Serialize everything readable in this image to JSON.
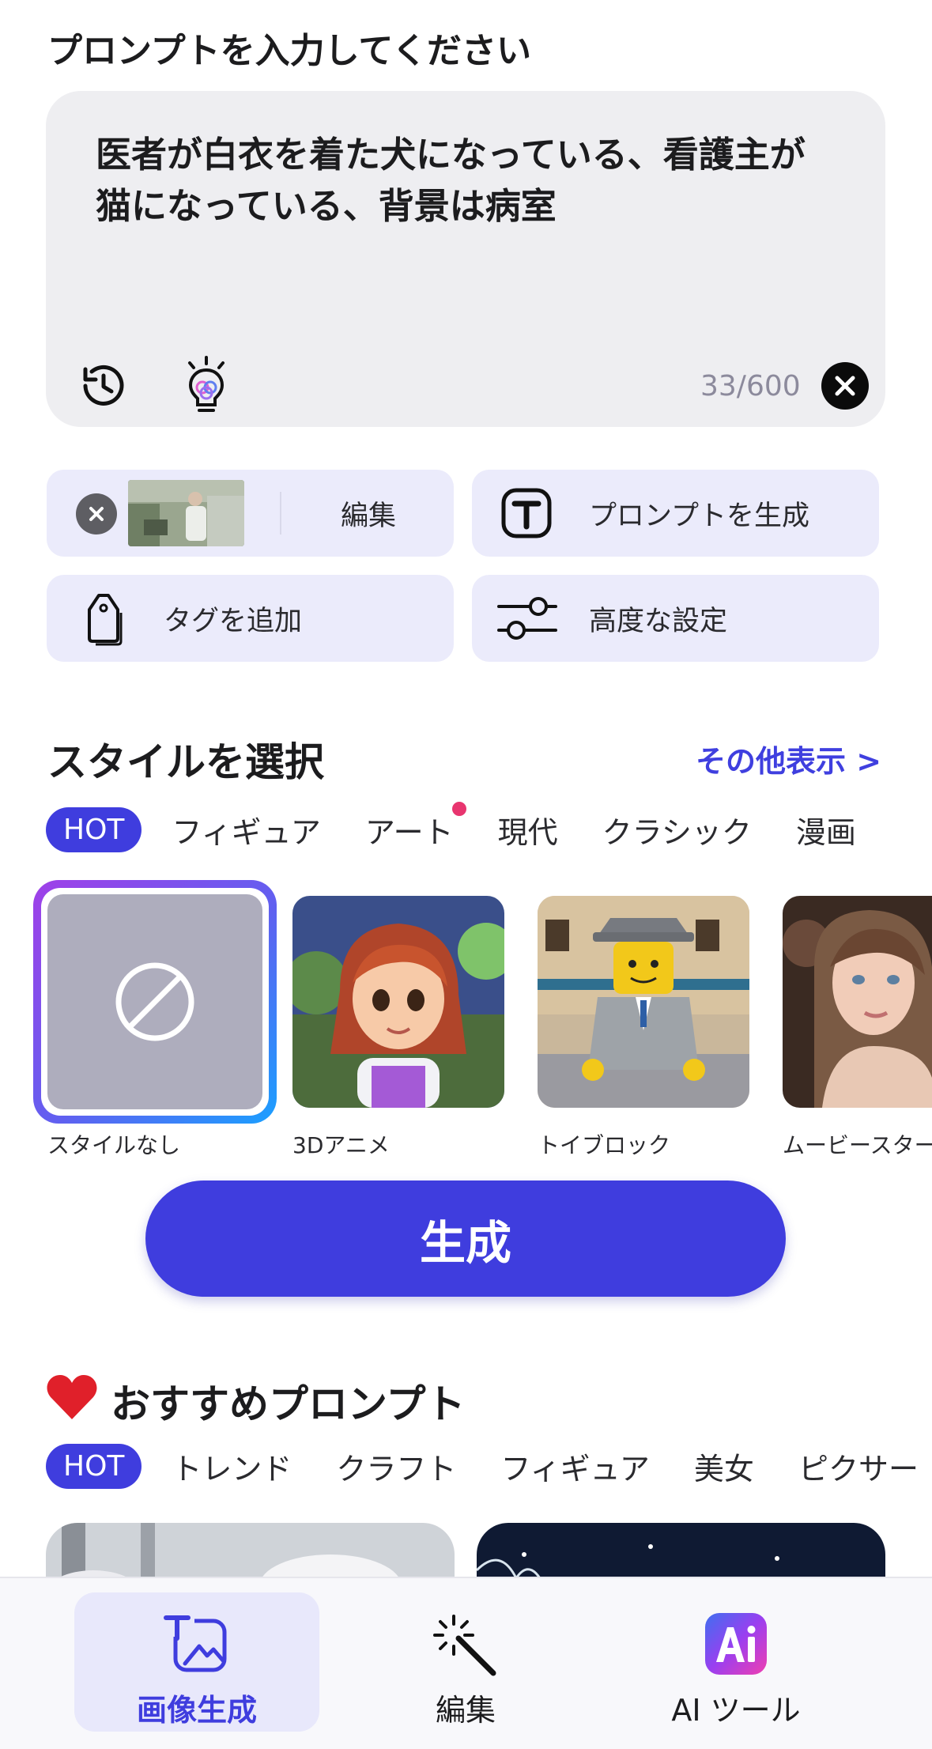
{
  "prompt_section": {
    "title": "プロンプトを入力してください",
    "text": "医者が白衣を着た犬になっている、看護主が猫になっている、背景は病室",
    "char_count": "33/600"
  },
  "actions": {
    "edit_label": "編集",
    "generate_prompt_label": "プロンプトを生成",
    "add_tag_label": "タグを追加",
    "advanced_label": "高度な設定"
  },
  "style_section": {
    "title": "スタイルを選択",
    "more_link": "その他表示 >",
    "tabs": [
      "HOT",
      "フィギュア",
      "アート",
      "現代",
      "クラシック",
      "漫画"
    ],
    "styles": [
      "スタイルなし",
      "3Dアニメ",
      "トイブロック",
      "ムービースター"
    ]
  },
  "generate_button": "生成",
  "recommend_section": {
    "title": "おすすめプロンプト",
    "tabs": [
      "HOT",
      "トレンド",
      "クラフト",
      "フィギュア",
      "美女",
      "ピクサー"
    ]
  },
  "bottom_nav": {
    "items": [
      "画像生成",
      "編集",
      "AI ツール"
    ],
    "active_index": 0
  },
  "colors": {
    "accent": "#3f3dde",
    "link": "#3f3fdf",
    "card_bg": "#ebebfb",
    "input_bg": "#eeeef1",
    "notification_dot": "#e8356f"
  },
  "icons": {
    "history": "history-icon",
    "inspire": "lightbulb-icon",
    "clear": "close-icon",
    "text_prompt": "text-t-icon",
    "tag": "tag-icon",
    "settings": "sliders-icon",
    "no_style": "no-style-icon",
    "heart": "heart-icon",
    "image_gen": "image-generate-icon",
    "edit": "magic-wand-icon",
    "ai_tools": "ai-logo-icon"
  }
}
